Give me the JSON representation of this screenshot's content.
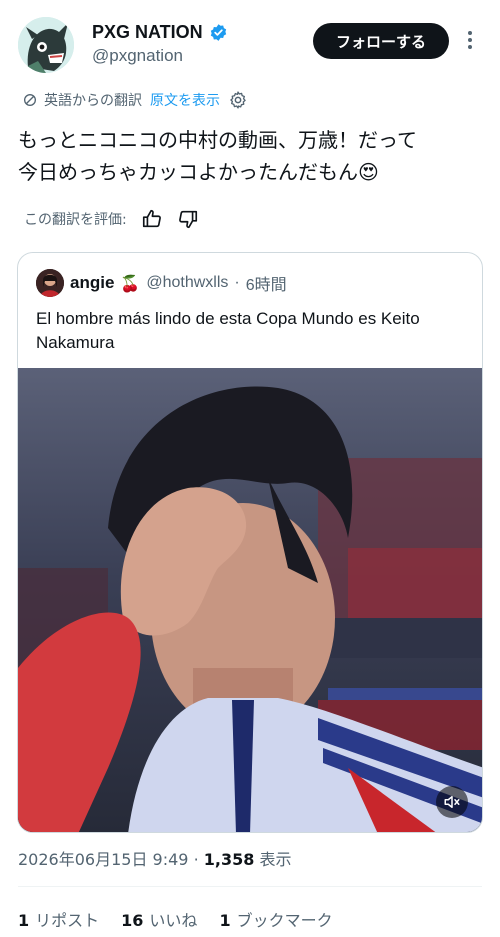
{
  "author": {
    "display_name": "PXG NATION",
    "handle": "@pxgnation",
    "verified": true,
    "avatar": "cartoon-creature-avatar"
  },
  "follow_label": "フォローする",
  "translation": {
    "from_label": "英語からの翻訳",
    "show_original_label": "原文を表示"
  },
  "tweet": {
    "line1": "もっとニコニコの中村の動画、万歳！だって",
    "line2": "今日めっちゃカッコよかったんだもん😍"
  },
  "rate": {
    "label": "この翻訳を評価:"
  },
  "quote": {
    "name": "angie",
    "emoji": "🍒",
    "handle": "@hothwxlls",
    "time": "6時間",
    "text": "El hombre más lindo de esta Copa Mundo es Keito Nakamura"
  },
  "meta": {
    "timestamp": "2026年06月15日 9:49",
    "views_count": "1,358",
    "views_label": "表示"
  },
  "stats": {
    "reposts_count": "1",
    "reposts_label": "リポスト",
    "likes_count": "16",
    "likes_label": "いいね",
    "bookmarks_count": "1",
    "bookmarks_label": "ブックマーク"
  },
  "colors": {
    "accent": "#1d9bf0",
    "text": "#0f1419",
    "muted": "#536471",
    "border": "#cfd9de"
  }
}
